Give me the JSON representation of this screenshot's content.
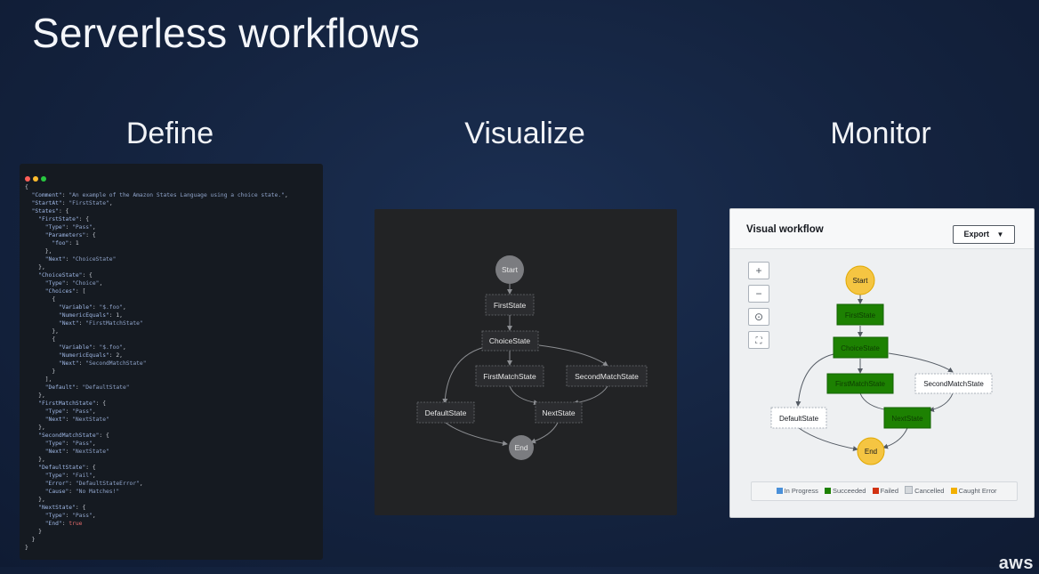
{
  "slide": {
    "title": "Serverless workflows",
    "brand": "aws"
  },
  "columns": [
    {
      "heading": "Define"
    },
    {
      "heading": "Visualize"
    },
    {
      "heading": "Monitor"
    }
  ],
  "editor": {
    "window_dot_colors": [
      "#ff5f57",
      "#febc2e",
      "#28c840"
    ],
    "code_lines": [
      "{",
      "  \"Comment\": \"An example of the Amazon States Language using a choice state.\",",
      "  \"StartAt\": \"FirstState\",",
      "  \"States\": {",
      "    \"FirstState\": {",
      "      \"Type\": \"Pass\",",
      "      \"Parameters\": {",
      "        \"foo\": 1",
      "      },",
      "      \"Next\": \"ChoiceState\"",
      "    },",
      "    \"ChoiceState\": {",
      "      \"Type\": \"Choice\",",
      "      \"Choices\": [",
      "        {",
      "          \"Variable\": \"$.foo\",",
      "          \"NumericEquals\": 1,",
      "          \"Next\": \"FirstMatchState\"",
      "        },",
      "        {",
      "          \"Variable\": \"$.foo\",",
      "          \"NumericEquals\": 2,",
      "          \"Next\": \"SecondMatchState\"",
      "        }",
      "      ],",
      "      \"Default\": \"DefaultState\"",
      "    },",
      "    \"FirstMatchState\": {",
      "      \"Type\": \"Pass\",",
      "      \"Next\": \"NextState\"",
      "    },",
      "    \"SecondMatchState\": {",
      "      \"Type\": \"Pass\",",
      "      \"Next\": \"NextState\"",
      "    },",
      "    \"DefaultState\": {",
      "      \"Type\": \"Fail\",",
      "      \"Error\": \"DefaultStateError\",",
      "      \"Cause\": \"No Matches!\"",
      "    },",
      "    \"NextState\": {",
      "      \"Type\": \"Pass\",",
      "      \"End\": true",
      "    }",
      "  }",
      "}"
    ]
  },
  "visualize": {
    "nodes": {
      "start": "Start",
      "first": "FirstState",
      "choice": "ChoiceState",
      "first_match": "FirstMatchState",
      "second_match": "SecondMatchState",
      "default": "DefaultState",
      "next": "NextState",
      "end": "End"
    }
  },
  "monitor": {
    "title": "Visual workflow",
    "export_label": "Export",
    "tools": [
      "+",
      "−",
      "⊙",
      "⛶"
    ],
    "nodes": {
      "start": "Start",
      "first": "FirstState",
      "choice": "ChoiceState",
      "first_match": "FirstMatchState",
      "second_match": "SecondMatchState",
      "default": "DefaultState",
      "next": "NextState",
      "end": "End"
    },
    "legend": [
      {
        "label": "In Progress",
        "color": "#4a90d9"
      },
      {
        "label": "Succeeded",
        "color": "#1d8102"
      },
      {
        "label": "Failed",
        "color": "#d13212"
      },
      {
        "label": "Cancelled",
        "color": "#d5d9dd"
      },
      {
        "label": "Caught Error",
        "color": "#f2b000"
      }
    ],
    "colors": {
      "succeeded": "#1d8102",
      "start_end": "#f5c542",
      "not_run": "#ffffff"
    }
  }
}
